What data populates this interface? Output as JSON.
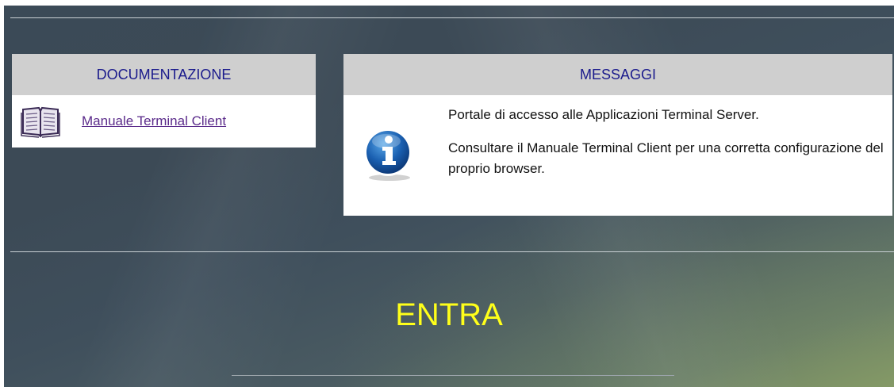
{
  "documentation": {
    "title": "DOCUMENTAZIONE",
    "items": [
      {
        "label": "Manuale Terminal Client",
        "icon": "book-icon"
      }
    ]
  },
  "messages": {
    "title": "MESSAGGI",
    "icon": "info-icon",
    "lines": [
      "Portale di accesso alle Applicazioni Terminal Server.",
      "Consultare il Manuale Terminal Client per una corretta configurazione del proprio browser."
    ]
  },
  "enter": {
    "label": "ENTRA"
  },
  "colors": {
    "header_text": "#1a1a8c",
    "link": "#5a2a8a",
    "enter_text": "#ffff1a",
    "panel_header_bg": "#cfcfcf"
  }
}
